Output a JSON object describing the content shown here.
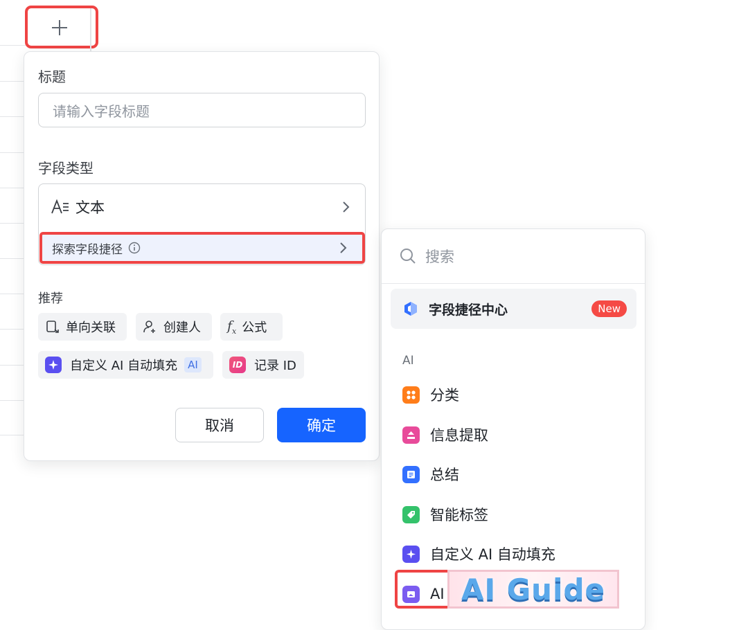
{
  "form": {
    "title_label": "标题",
    "title_placeholder": "请输入字段标题",
    "type_label": "字段类型",
    "type_value": "文本",
    "explore_label": "探索字段捷径",
    "recommend_label": "推荐",
    "recommend_chips": [
      "单向关联",
      "创建人",
      "公式"
    ],
    "custom_ai_chip": "自定义 AI 自动填充",
    "ai_badge": "AI",
    "record_id_chip": "记录 ID",
    "cancel_label": "取消",
    "confirm_label": "确定"
  },
  "dropdown": {
    "search_placeholder": "搜索",
    "center_label": "字段捷径中心",
    "new_badge": "New",
    "section_ai": "AI",
    "items": [
      {
        "label": "分类",
        "color": "#ff7d1a",
        "icon": "category-icon"
      },
      {
        "label": "信息提取",
        "color": "#e84b9a",
        "icon": "extract-icon"
      },
      {
        "label": "总结",
        "color": "#3370ff",
        "icon": "summary-icon"
      },
      {
        "label": "智能标签",
        "color": "#34c26b",
        "icon": "tag-icon"
      },
      {
        "label": "自定义 AI 自动填充",
        "color": "#5a4ff0",
        "icon": "sparkle-icon"
      },
      {
        "label": "AI",
        "color": "#7b5cf0",
        "icon": "ai-image-icon"
      }
    ]
  },
  "watermark": "AI Guide",
  "colors": {
    "primary": "#1664ff",
    "highlight": "#ef4444",
    "new_badge": "#f54a45"
  }
}
